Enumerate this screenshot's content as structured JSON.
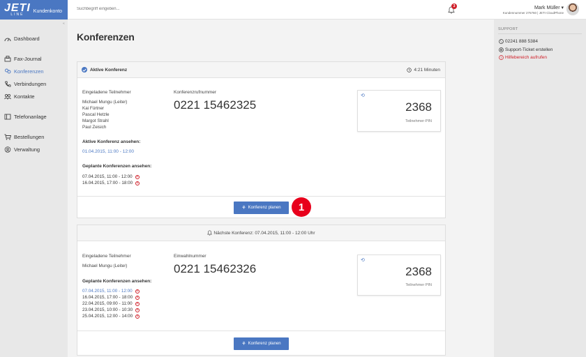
{
  "brand": {
    "logo": "JETI",
    "logo_sub": "LINE",
    "portal": "Kundenkonto"
  },
  "search": {
    "placeholder": "Suchbegriff eingeben..."
  },
  "notifications": {
    "count": "3"
  },
  "user": {
    "name": "Mark Müller",
    "sub": "Kundennummer 275760 | JETI CloudPhone"
  },
  "nav": [
    {
      "label": "Dashboard",
      "icon": "gauge-icon"
    },
    {
      "label": "Fax-Journal",
      "icon": "fax-icon"
    },
    {
      "label": "Konferenzen",
      "icon": "conference-icon",
      "active": true
    },
    {
      "label": "Verbindungen",
      "icon": "phone-icon"
    },
    {
      "label": "Kontakte",
      "icon": "contacts-icon"
    },
    {
      "label": "Telefonanlage",
      "icon": "pbx-icon"
    },
    {
      "label": "Bestellungen",
      "icon": "cart-icon"
    },
    {
      "label": "Verwaltung",
      "icon": "user-circle-icon"
    }
  ],
  "page": {
    "title": "Konferenzen"
  },
  "active_conf": {
    "title": "Aktive Konferenz",
    "duration": "4:21 Minuten",
    "invited_label": "Eingeladene Teilnehmer",
    "participants": [
      "Michael Mungu (Leiter)",
      "Kai Fürtner",
      "Pascal Hetzle",
      "Margot Strahl",
      "Paul Zeisich"
    ],
    "number_label": "Konferenzrufnummer",
    "number": "0221 15462325",
    "pin": "2368",
    "pin_label": "Teilnehmer-PIN",
    "view_active_label": "Aktive Konferenz ansehen:",
    "active_entry": "01.04.2015, 11:00 - 12:00",
    "planned_label": "Geplante Konferenzen ansehen:",
    "planned": [
      "07.04.2015, 11:00 - 12:00",
      "16.04.2015, 17:00 - 18:00"
    ],
    "button": "Konferenz planen"
  },
  "next_conf": {
    "title": "Nächste Konferenz: 07.04.2015, 11:00 - 12:00 Uhr",
    "invited_label": "Eingeladene Teilnehmer",
    "participants": [
      "Michael Mungu (Leiter)"
    ],
    "number_label": "Einwahlnummer",
    "number": "0221 15462326",
    "pin": "2368",
    "pin_label": "Teilnehmer PIN",
    "planned_label": "Geplante Konferenzen ansehen:",
    "planned": [
      "07.04.2015, 11:00 - 12:00",
      "16.04.2015, 17:00 - 18:00",
      "22.04.2015, 09:00 - 11:00",
      "23.04.2015, 10:00 - 10:30",
      "25.04.2015, 12:00 - 14:00"
    ],
    "button": "Konferenz planen"
  },
  "marker": "1",
  "support": {
    "heading": "SUPPORT",
    "phone": "02241 888 5384",
    "ticket": "Support-Ticket erstellen",
    "help": "Hilfebereich aufrufen"
  },
  "colors": {
    "accent": "#4a77c2",
    "danger": "#d0202a",
    "marker": "#e8001c"
  }
}
